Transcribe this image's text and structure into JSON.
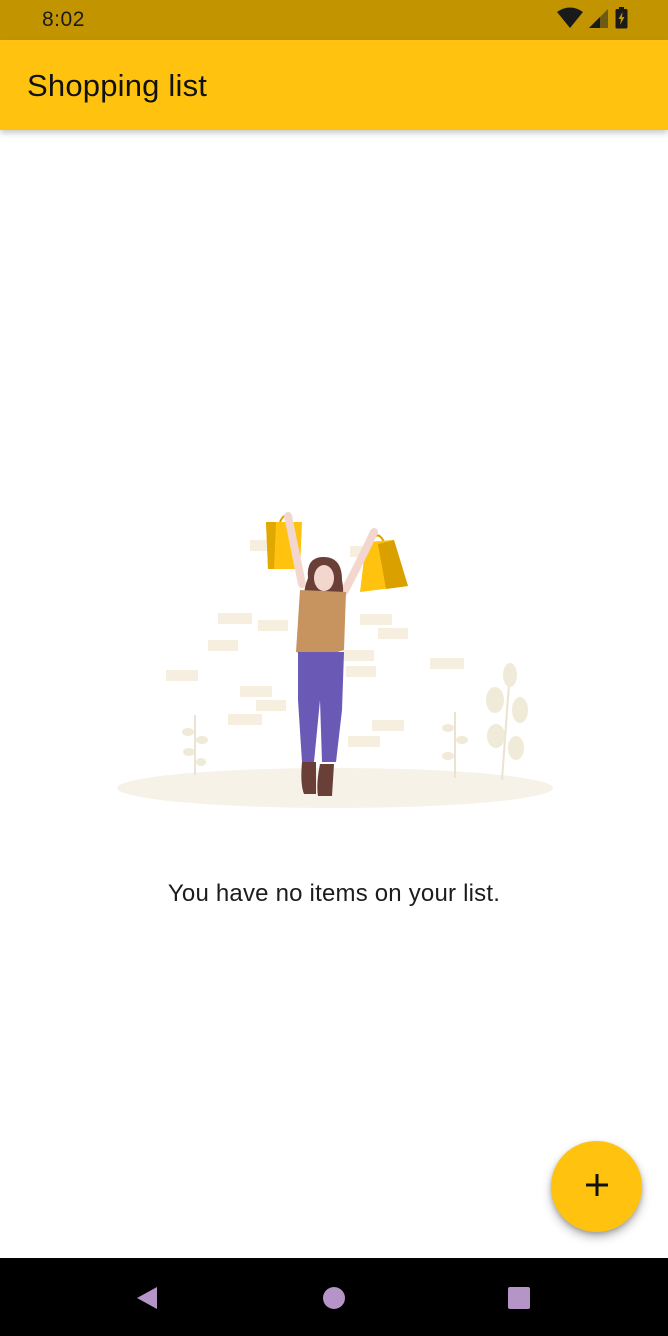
{
  "status_bar": {
    "time": "8:02",
    "icons": [
      "wifi-icon",
      "signal-icon",
      "battery-icon"
    ]
  },
  "app_bar": {
    "title": "Shopping list",
    "background": "#ffc30f"
  },
  "empty_state": {
    "illustration": "woman-with-shopping-bags-illustration",
    "message": "You have no items on your list."
  },
  "fab": {
    "icon": "plus-icon",
    "color": "#ffc30f"
  },
  "nav_bar": {
    "buttons": [
      "back-icon",
      "home-icon",
      "recents-icon"
    ],
    "button_color": "#b594c8"
  }
}
